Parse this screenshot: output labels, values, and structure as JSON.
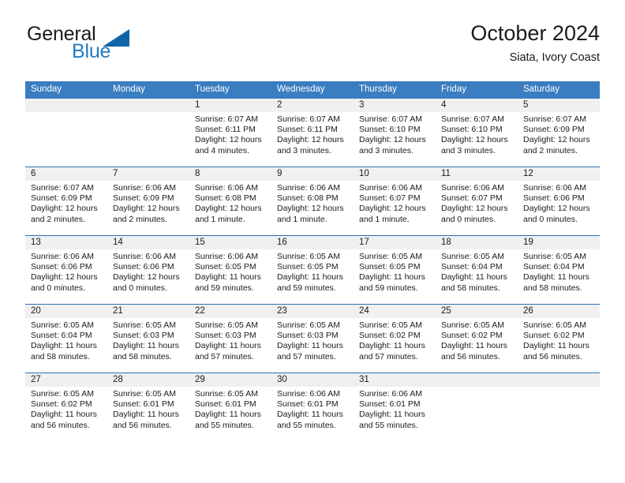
{
  "brand": {
    "name_top": "General",
    "name_bottom": "Blue",
    "accent_color": "#1f7bc1",
    "triangle_color": "#1264a8"
  },
  "header": {
    "title": "October 2024",
    "subtitle": "Siata, Ivory Coast"
  },
  "theme": {
    "header_row_bg": "#3a7dc0",
    "row_divider": "#2f6fad",
    "daynum_band_bg": "#f0f0f0",
    "text_color": "#1b1b1b"
  },
  "weekday_headers": [
    "Sunday",
    "Monday",
    "Tuesday",
    "Wednesday",
    "Thursday",
    "Friday",
    "Saturday"
  ],
  "labels": {
    "sunrise_prefix": "Sunrise:",
    "sunset_prefix": "Sunset:",
    "daylight_prefix": "Daylight:"
  },
  "weeks": [
    [
      {
        "day": "",
        "lines": []
      },
      {
        "day": "",
        "lines": []
      },
      {
        "day": "1",
        "lines": [
          "Sunrise: 6:07 AM",
          "Sunset: 6:11 PM",
          "Daylight: 12 hours",
          "and 4 minutes."
        ]
      },
      {
        "day": "2",
        "lines": [
          "Sunrise: 6:07 AM",
          "Sunset: 6:11 PM",
          "Daylight: 12 hours",
          "and 3 minutes."
        ]
      },
      {
        "day": "3",
        "lines": [
          "Sunrise: 6:07 AM",
          "Sunset: 6:10 PM",
          "Daylight: 12 hours",
          "and 3 minutes."
        ]
      },
      {
        "day": "4",
        "lines": [
          "Sunrise: 6:07 AM",
          "Sunset: 6:10 PM",
          "Daylight: 12 hours",
          "and 3 minutes."
        ]
      },
      {
        "day": "5",
        "lines": [
          "Sunrise: 6:07 AM",
          "Sunset: 6:09 PM",
          "Daylight: 12 hours",
          "and 2 minutes."
        ]
      }
    ],
    [
      {
        "day": "6",
        "lines": [
          "Sunrise: 6:07 AM",
          "Sunset: 6:09 PM",
          "Daylight: 12 hours",
          "and 2 minutes."
        ]
      },
      {
        "day": "7",
        "lines": [
          "Sunrise: 6:06 AM",
          "Sunset: 6:09 PM",
          "Daylight: 12 hours",
          "and 2 minutes."
        ]
      },
      {
        "day": "8",
        "lines": [
          "Sunrise: 6:06 AM",
          "Sunset: 6:08 PM",
          "Daylight: 12 hours",
          "and 1 minute."
        ]
      },
      {
        "day": "9",
        "lines": [
          "Sunrise: 6:06 AM",
          "Sunset: 6:08 PM",
          "Daylight: 12 hours",
          "and 1 minute."
        ]
      },
      {
        "day": "10",
        "lines": [
          "Sunrise: 6:06 AM",
          "Sunset: 6:07 PM",
          "Daylight: 12 hours",
          "and 1 minute."
        ]
      },
      {
        "day": "11",
        "lines": [
          "Sunrise: 6:06 AM",
          "Sunset: 6:07 PM",
          "Daylight: 12 hours",
          "and 0 minutes."
        ]
      },
      {
        "day": "12",
        "lines": [
          "Sunrise: 6:06 AM",
          "Sunset: 6:06 PM",
          "Daylight: 12 hours",
          "and 0 minutes."
        ]
      }
    ],
    [
      {
        "day": "13",
        "lines": [
          "Sunrise: 6:06 AM",
          "Sunset: 6:06 PM",
          "Daylight: 12 hours",
          "and 0 minutes."
        ]
      },
      {
        "day": "14",
        "lines": [
          "Sunrise: 6:06 AM",
          "Sunset: 6:06 PM",
          "Daylight: 12 hours",
          "and 0 minutes."
        ]
      },
      {
        "day": "15",
        "lines": [
          "Sunrise: 6:06 AM",
          "Sunset: 6:05 PM",
          "Daylight: 11 hours",
          "and 59 minutes."
        ]
      },
      {
        "day": "16",
        "lines": [
          "Sunrise: 6:05 AM",
          "Sunset: 6:05 PM",
          "Daylight: 11 hours",
          "and 59 minutes."
        ]
      },
      {
        "day": "17",
        "lines": [
          "Sunrise: 6:05 AM",
          "Sunset: 6:05 PM",
          "Daylight: 11 hours",
          "and 59 minutes."
        ]
      },
      {
        "day": "18",
        "lines": [
          "Sunrise: 6:05 AM",
          "Sunset: 6:04 PM",
          "Daylight: 11 hours",
          "and 58 minutes."
        ]
      },
      {
        "day": "19",
        "lines": [
          "Sunrise: 6:05 AM",
          "Sunset: 6:04 PM",
          "Daylight: 11 hours",
          "and 58 minutes."
        ]
      }
    ],
    [
      {
        "day": "20",
        "lines": [
          "Sunrise: 6:05 AM",
          "Sunset: 6:04 PM",
          "Daylight: 11 hours",
          "and 58 minutes."
        ]
      },
      {
        "day": "21",
        "lines": [
          "Sunrise: 6:05 AM",
          "Sunset: 6:03 PM",
          "Daylight: 11 hours",
          "and 58 minutes."
        ]
      },
      {
        "day": "22",
        "lines": [
          "Sunrise: 6:05 AM",
          "Sunset: 6:03 PM",
          "Daylight: 11 hours",
          "and 57 minutes."
        ]
      },
      {
        "day": "23",
        "lines": [
          "Sunrise: 6:05 AM",
          "Sunset: 6:03 PM",
          "Daylight: 11 hours",
          "and 57 minutes."
        ]
      },
      {
        "day": "24",
        "lines": [
          "Sunrise: 6:05 AM",
          "Sunset: 6:02 PM",
          "Daylight: 11 hours",
          "and 57 minutes."
        ]
      },
      {
        "day": "25",
        "lines": [
          "Sunrise: 6:05 AM",
          "Sunset: 6:02 PM",
          "Daylight: 11 hours",
          "and 56 minutes."
        ]
      },
      {
        "day": "26",
        "lines": [
          "Sunrise: 6:05 AM",
          "Sunset: 6:02 PM",
          "Daylight: 11 hours",
          "and 56 minutes."
        ]
      }
    ],
    [
      {
        "day": "27",
        "lines": [
          "Sunrise: 6:05 AM",
          "Sunset: 6:02 PM",
          "Daylight: 11 hours",
          "and 56 minutes."
        ]
      },
      {
        "day": "28",
        "lines": [
          "Sunrise: 6:05 AM",
          "Sunset: 6:01 PM",
          "Daylight: 11 hours",
          "and 56 minutes."
        ]
      },
      {
        "day": "29",
        "lines": [
          "Sunrise: 6:05 AM",
          "Sunset: 6:01 PM",
          "Daylight: 11 hours",
          "and 55 minutes."
        ]
      },
      {
        "day": "30",
        "lines": [
          "Sunrise: 6:06 AM",
          "Sunset: 6:01 PM",
          "Daylight: 11 hours",
          "and 55 minutes."
        ]
      },
      {
        "day": "31",
        "lines": [
          "Sunrise: 6:06 AM",
          "Sunset: 6:01 PM",
          "Daylight: 11 hours",
          "and 55 minutes."
        ]
      },
      {
        "day": "",
        "lines": []
      },
      {
        "day": "",
        "lines": []
      }
    ]
  ]
}
